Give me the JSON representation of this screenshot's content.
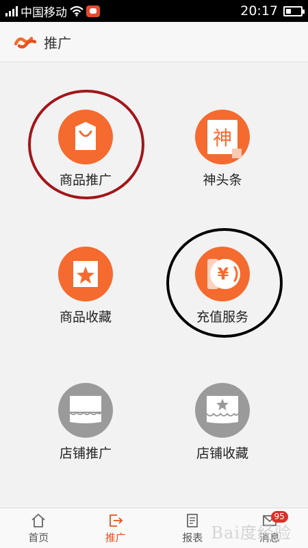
{
  "status_bar": {
    "carrier": "中国移动",
    "time": "20:17"
  },
  "header": {
    "title": "推广"
  },
  "menu": {
    "items": [
      {
        "label": "商品推广",
        "icon": "shopping-bag-icon"
      },
      {
        "label": "神头条",
        "icon": "headline-icon",
        "icon_text": "神"
      },
      {
        "label": "商品收藏",
        "icon": "star-box-icon"
      },
      {
        "label": "充值服务",
        "icon": "yuan-coin-icon",
        "icon_text": "¥"
      },
      {
        "label": "店铺推广",
        "icon": "storefront-icon"
      },
      {
        "label": "店铺收藏",
        "icon": "storefront-star-icon"
      }
    ]
  },
  "tabs": [
    {
      "label": "首页",
      "icon": "home-icon",
      "active": false
    },
    {
      "label": "推广",
      "icon": "share-icon",
      "active": true
    },
    {
      "label": "报表",
      "icon": "report-icon",
      "active": false
    },
    {
      "label": "消息",
      "icon": "mail-icon",
      "active": false,
      "badge": "95"
    }
  ],
  "watermark": "Bai度经验",
  "colors": {
    "accent": "#f56a2e",
    "active_tab": "#e8501c",
    "inactive_icon": "#9a9a9a",
    "ring_red": "#a31519",
    "ring_black": "#000000"
  }
}
